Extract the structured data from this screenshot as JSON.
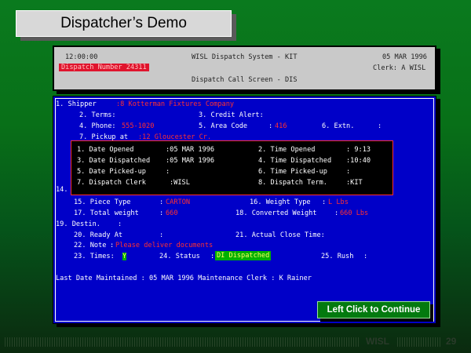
{
  "slide_title": "Dispatcher’s Demo",
  "header": {
    "time": "12:00:00",
    "system_title": "WISL Dispatch System - KIT",
    "date": "05 MAR 1996",
    "dispatch_number": "Dispatch Number 24311",
    "clerk": "Clerk: A WISL",
    "screen_name": "Dispatch Call Screen - DIS"
  },
  "form": {
    "shipper_label": "1. Shipper",
    "shipper_value": ":8 Kotterman Fixtures Company",
    "terms_label": "2. Terms:",
    "credit_alert_label": "3. Credit Alert:",
    "phone_label": "4. Phone:",
    "phone_value": "555-1020",
    "area_code_label": "5. Area Code",
    "area_code_value": "416",
    "extn_label": "6. Extn.",
    "colon": ":",
    "pickup_label": "7. Pickup at",
    "pickup_value": ":12 Gloucester Cr.",
    "popup": {
      "date_opened_label": "1. Date Opened",
      "date_opened_value": ":05 MAR 1996",
      "time_opened_label": "2. Time Opened",
      "time_opened_value": ": 9:13",
      "date_dispatched_label": "3. Date Dispatched",
      "date_dispatched_value": ":05 MAR 1996",
      "time_dispatched_label": "4. Time Dispatched",
      "time_dispatched_value": ":10:40",
      "date_pickedup_label": "5. Date Picked-up",
      "date_pickedup_value": ":",
      "time_pickedup_label": "6. Time Picked-up",
      "time_pickedup_value": ":",
      "dispatch_clerk_label": "7. Dispatch Clerk",
      "dispatch_clerk_value": ":WISL",
      "dispatch_term_label": "8. Dispatch Term.",
      "dispatch_term_value": ":KIT"
    },
    "row14_label": "14.",
    "piece_type_label": "15. Piece Type",
    "piece_type_value": "CARTON",
    "weight_type_label": "16. Weight Type",
    "weight_type_value": "L Lbs",
    "total_weight_label": "17. Total weight",
    "total_weight_value": "660",
    "converted_weight_label": "18. Converted Weight",
    "converted_weight_value": "660 Lbs",
    "destin_label": "19. Destin.",
    "ready_at_label": "20. Ready At",
    "actual_close_label": "21. Actual Close Time:",
    "note_label": "22. Note",
    "note_value": "Please deliver documents",
    "times_label": "23. Times:",
    "times_value": "Y",
    "status_label": "24. Status",
    "status_value": "DI Dispatched",
    "rush_label": "25. Rush",
    "last_maintained": "Last Date Maintained : 05 MAR 1996 Maintenance Clerk : K Rainer"
  },
  "continue_button": "Left Click to Continue",
  "footer": {
    "brand": "WISL",
    "page_number": "29"
  },
  "colors": {
    "background_green": "#087018",
    "screen_blue": "#0000c8",
    "field_red": "#ff3030",
    "status_green": "#00b000"
  }
}
